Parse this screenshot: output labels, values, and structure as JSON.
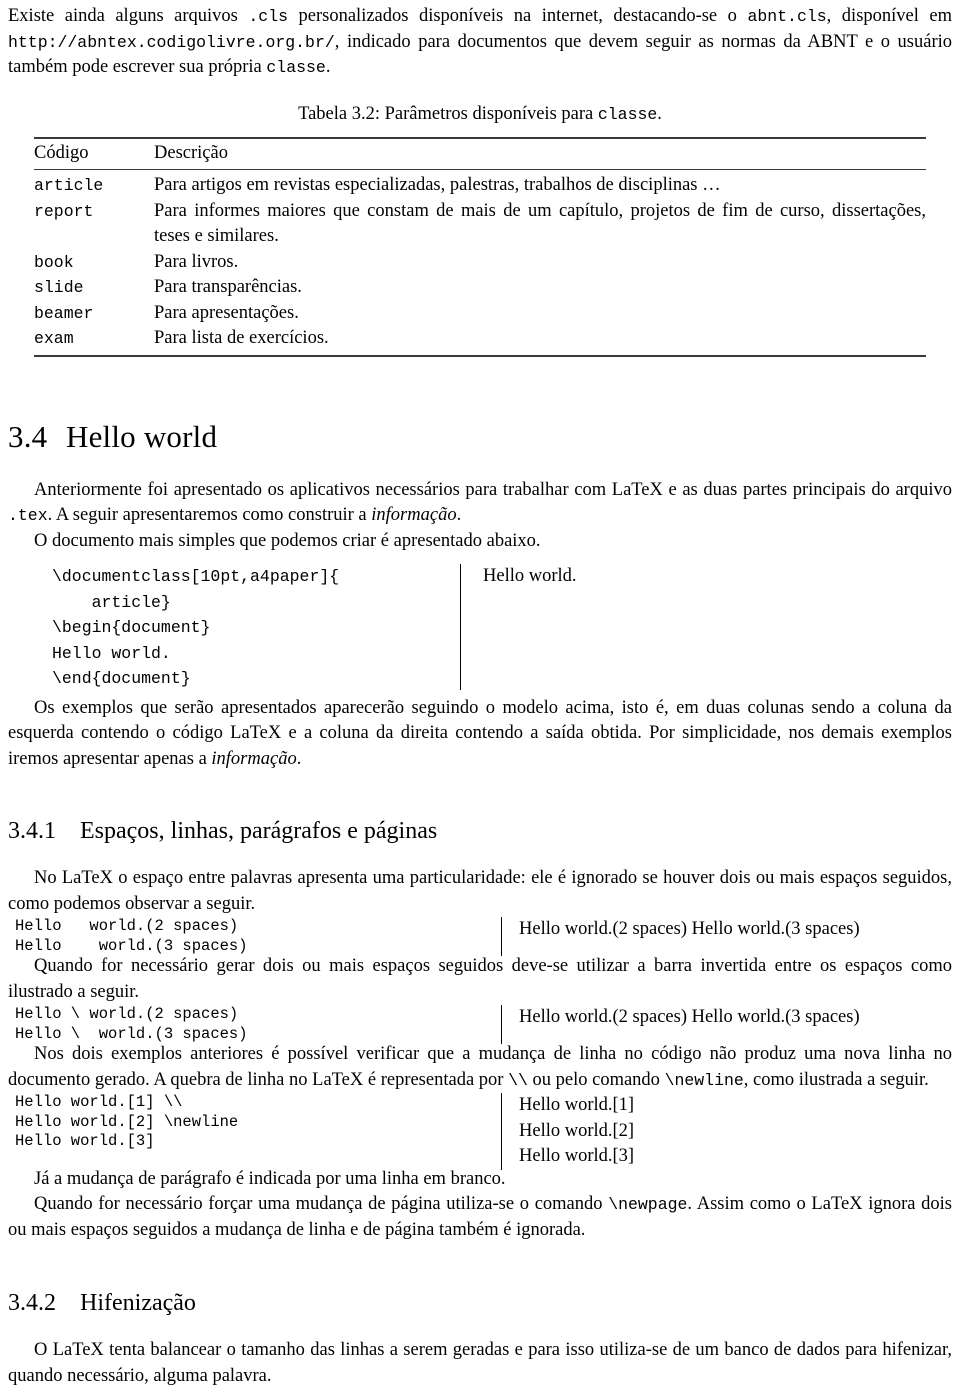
{
  "document": {
    "intro_paragraph": {
      "seg1": "Existe ainda alguns arquivos ",
      "code1": ".cls",
      "seg2": " personalizados disponíveis na internet, destacando-se o ",
      "code2": "abnt.cls",
      "seg3": ", disponível em ",
      "code3": "http://abntex.codigolivre.org.br/",
      "seg4": ", indicado para documentos que devem seguir as normas da ABNT e o usuário também pode escrever sua própria ",
      "code4": "classe",
      "seg5": "."
    },
    "table_caption": {
      "label": "Tabela 3.2:",
      "text_before": " Parâmetros disponíveis para ",
      "code": "classe",
      "text_after": "."
    },
    "table": {
      "headers": [
        "Código",
        "Descrição"
      ],
      "rows": [
        {
          "code": "article",
          "desc": "Para artigos em revistas especializadas, palestras, trabalhos de disciplinas …"
        },
        {
          "code": "report",
          "desc": "Para informes maiores que constam de mais de um capítulo, projetos de fim de curso, dissertações, teses e similares."
        },
        {
          "code": "book",
          "desc": "Para livros."
        },
        {
          "code": "slide",
          "desc": "Para transparências."
        },
        {
          "code": "beamer",
          "desc": "Para apresentações."
        },
        {
          "code": "exam",
          "desc": "Para lista de exercícios."
        }
      ]
    },
    "section_34": {
      "number": "3.4",
      "title": "Hello world",
      "para1": {
        "seg1": "Anteriormente foi apresentado os aplicativos necessários para trabalhar com LaTeX e as duas partes principais do arquivo ",
        "code1": ".tex",
        "seg2": ". A seguir apresentaremos como construir a ",
        "italic1": "informação",
        "seg3": "."
      },
      "para2": "O documento mais simples que podemos criar é apresentado abaixo.",
      "example1": {
        "code": "\\documentclass[10pt,a4paper]{\n    article}\n\\begin{document}\nHello world.\n\\end{document}",
        "output": "Hello world."
      },
      "para3": {
        "seg1": "Os exemplos que serão apresentados aparecerão seguindo o modelo acima, isto é, em duas colunas sendo a coluna da esquerda contendo o código LaTeX e a coluna da direita contendo a saída obtida. Por simplicidade, nos demais exemplos iremos apresentar apenas a ",
        "italic1": "informação",
        "seg2": "."
      }
    },
    "section_341": {
      "number": "3.4.1",
      "title": "Espaços, linhas, parágrafos e páginas",
      "para1": "No LaTeX o espaço entre palavras apresenta uma particularidade: ele é ignorado se houver dois ou mais espaços seguidos, como podemos observar a seguir.",
      "example1": {
        "code": "Hello   world.(2 spaces)\nHello    world.(3 spaces)",
        "output": "Hello world.(2 spaces) Hello world.(3 spaces)"
      },
      "para2": "Quando for necessário gerar dois ou mais espaços seguidos deve-se utilizar a barra invertida entre os espaços como ilustrado a seguir.",
      "example2": {
        "code": "Hello \\ world.(2 spaces)\nHello \\  world.(3 spaces)",
        "output": "Hello  world.(2 spaces) Hello  world.(3 spaces)"
      },
      "para3": {
        "seg1": "Nos dois exemplos anteriores é possível verificar que a mudança de linha no código não produz uma nova linha no documento gerado. A quebra de linha no LaTeX é representada por ",
        "code1": "\\\\",
        "seg2": " ou pelo comando ",
        "code2": "\\newline",
        "seg3": ", como ilustrada a seguir."
      },
      "example3": {
        "code": "Hello world.[1] \\\\\nHello world.[2] \\newline\nHello world.[3]",
        "output_lines": [
          "Hello world.[1]",
          "Hello world.[2]",
          "Hello world.[3]"
        ]
      },
      "para4": "Já a mudança de parágrafo é indicada por uma linha em branco.",
      "para5": {
        "seg1": "Quando for necessário forçar uma mudança de página utiliza-se o comando ",
        "code1": "\\newpage",
        "seg2": ". Assim como o LaTeX ignora dois ou mais espaços seguidos a mudança de linha e de página também é ignorada."
      }
    },
    "section_342": {
      "number": "3.4.2",
      "title": "Hifenização",
      "para1": "O LaTeX tenta balancear o tamanho das linhas a serem geradas e para isso utiliza-se de um banco de dados para hifenizar, quando necessário, alguma palavra."
    }
  }
}
